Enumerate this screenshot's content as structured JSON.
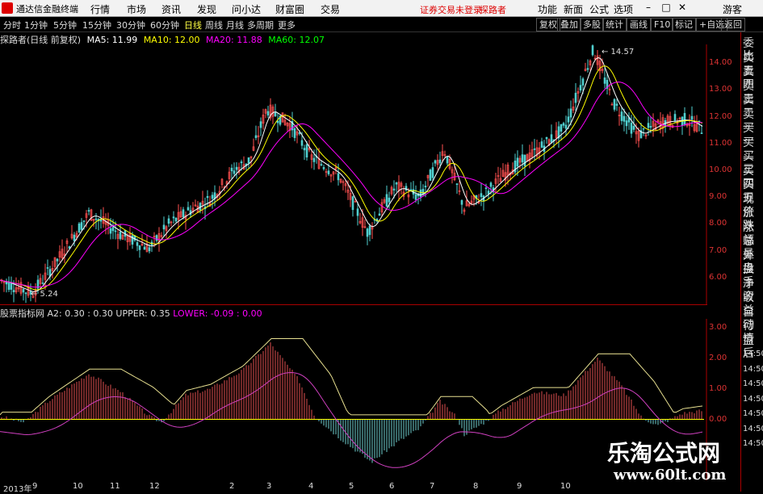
{
  "menubar": {
    "app_title": "通达信金融终端",
    "items": [
      "行情",
      "市场",
      "资讯",
      "发现",
      "问小达",
      "财富圈",
      "交易"
    ],
    "warning": "证券交易未登录",
    "user": "探路者",
    "right": [
      "功能",
      "新面",
      "公式",
      "选项"
    ],
    "guest": "游客"
  },
  "toolbar": {
    "periods": [
      "分时",
      "1分钟",
      "5分钟",
      "15分钟",
      "30分钟",
      "60分钟",
      "日线",
      "周线",
      "月线",
      "多周期",
      "更多"
    ],
    "selected": "日线",
    "right": [
      "复权",
      "叠加",
      "多股",
      "统计",
      "画线",
      "F10",
      "标记",
      "+自选",
      "返回"
    ]
  },
  "main_info": {
    "name": "探路者(日线 前复权)",
    "ma5": "MA5: 11.99",
    "ma10": "MA10: 12.00",
    "ma20": "MA20: 11.88",
    "ma60": "MA60: 12.07"
  },
  "price_labels": {
    "high": "14.57",
    "low": "5.24"
  },
  "y_axis_main": [
    "14.00",
    "13.00",
    "12.00",
    "11.00",
    "10.00",
    "9.00",
    "8.00",
    "7.00",
    "6.00"
  ],
  "indicator_info": {
    "name": "股票指标网",
    "a2": "A2: 0.30 : 0.30",
    "upper": "UPPER: 0.35",
    "lower": "LOWER: -0.09 : 0.00"
  },
  "y_axis_ind": [
    "3.00",
    "2.00",
    "1.00",
    "0.00"
  ],
  "x_axis": [
    "2013年",
    "9",
    "10",
    "11",
    "12",
    "2",
    "3",
    "4",
    "5",
    "6",
    "7",
    "8",
    "9",
    "10"
  ],
  "right_panel": [
    "委比",
    "卖五",
    "卖四",
    "卖三",
    "卖二",
    "卖一",
    "买一",
    "买二",
    "买三",
    "买四",
    "买五",
    "现价",
    "涨跌",
    "涨幅",
    "总量",
    "外盘",
    "换手",
    "净资",
    "收益",
    "自动",
    "行情",
    "盘后",
    "14:50",
    "14:50",
    "14:50",
    "14:50",
    "14:50",
    "14:50",
    "14:50"
  ],
  "watermark": {
    "title": "乐淘公式网",
    "url": "www.60lt.com"
  },
  "colors": {
    "ma5": "#ffffff",
    "ma10": "#ffff00",
    "ma20": "#ff00ff",
    "ma60": "#00ff00",
    "up": "#ff5050",
    "down": "#50d0d0"
  }
}
